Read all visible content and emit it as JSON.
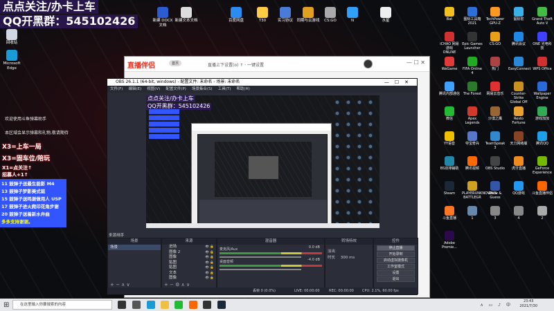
{
  "overlay": {
    "title": "点点关注/办卡上车",
    "qq": "QQ开黑群：545102426"
  },
  "desktop_top_icons": [
    {
      "label": "新建 DOCX 文档",
      "color": "#2b5cd1"
    },
    {
      "label": "新建文本文档",
      "color": "#dddddd"
    },
    {
      "label": "百度网盘",
      "color": "#2a8cf0"
    },
    {
      "label": "T30",
      "color": "#ffcc44"
    },
    {
      "label": "实习协议",
      "color": "#4a7bd8"
    },
    {
      "label": "同期与云游戏",
      "color": "#e0a020"
    },
    {
      "label": "CS:GO",
      "color": "#aaaaaa"
    },
    {
      "label": "N",
      "color": "#30a0ff"
    },
    {
      "label": "水星",
      "color": "#eeeeee"
    }
  ],
  "desktop_left_icons": [
    {
      "label": "回收站",
      "color": "#cfd8e0"
    },
    {
      "label": "Microsoft Edge",
      "color": "#1a9bd8"
    }
  ],
  "side_notes": [
    "欢迎使用斗鱼弹幕助手",
    "本区域会显示弹幕和礼物,敬请期待"
  ],
  "red_tags": [
    "X3=上车一局",
    "X3=固车位/陪玩",
    "X1=点关注↑",
    "招募人+1↑"
  ],
  "bluebox": {
    "lines": [
      "11 鼓弹子送最生能影 M4",
      "13 鼓弹子梦影美式驱",
      "15 鼓弹子送鸣谢做用人 USP",
      "17 鼓弹子进火爬印花角步谢",
      "20 鼓弹子送着新水弁曲"
    ],
    "footer": "多多支持谢谢。"
  },
  "browser": {
    "logo": "直播伴侣",
    "pill": "首页",
    "tabs": "直播上下设置(o) ↑ · 一键设置"
  },
  "obs": {
    "title": "OBS 26.1.1 (64-bit, windows) - 配置文件: 未命名 - 场景: 未命名",
    "menu": [
      "文件(F)",
      "编辑(E)",
      "视图(V)",
      "配置文件(P)",
      "场景集合(S)",
      "工具(T)",
      "帮助(H)"
    ],
    "preview_overlay_title": "点点关注/办卡上车",
    "preview_overlay_qq": "QQ开黑群：545102426",
    "dock_title_scene_label": "来源排序",
    "scenes_header": "场景",
    "scenes": [
      "场景"
    ],
    "sources_header": "来源",
    "sources": [
      "进场",
      "图像 2",
      "图像",
      "贴图",
      "贴图",
      "文本",
      "图像"
    ],
    "mixer_header": "混音器",
    "mixer": [
      {
        "name": "麦克风/Aux",
        "db": "0.0 dB"
      },
      {
        "name": "桌面音频",
        "db": "-4.0 dB"
      }
    ],
    "transitions_header": "转场特效",
    "transition_type": "淡出",
    "transition_duration_label": "时长",
    "transition_duration": "300 ms",
    "controls_header": "控件",
    "controls": [
      "停止直播",
      "开始录制",
      "启动虚拟摄像机",
      "工作室模式",
      "设置",
      "退出"
    ],
    "status": {
      "drop": "丢帧 0 (0.0%)",
      "live": "LIVE: 00:00:00",
      "rec": "REC: 00:00:00",
      "cpu": "CPU: 2.1%, 60.00 fps"
    }
  },
  "desktop_right_icons": [
    {
      "label": "Bat",
      "color": "#f0c020"
    },
    {
      "label": "图标工具箱 2021",
      "color": "#2c6fd8"
    },
    {
      "label": "TechPower GPU-Z",
      "color": "#ff9922"
    },
    {
      "label": "鼠标宏",
      "color": "#3ab0e8"
    },
    {
      "label": "Grand Theft Auto V",
      "color": "#44bb44"
    },
    {
      "label": "iCHAO 网易游戏 ONLINE",
      "color": "#d03030"
    },
    {
      "label": "Epic Games Launcher",
      "color": "#333333"
    },
    {
      "label": "CS:GO",
      "color": "#e8a018"
    },
    {
      "label": "腾讯会议",
      "color": "#1e88e5"
    },
    {
      "label": "ONE 光电科技",
      "color": "#4040ff"
    },
    {
      "label": "WeGame",
      "color": "#e03a3a"
    },
    {
      "label": "FIFA Online 4",
      "color": "#22aa22"
    },
    {
      "label": "热门",
      "color": "#aa4444"
    },
    {
      "label": "EasyConnect",
      "color": "#2a88d8"
    },
    {
      "label": "WPS Office",
      "color": "#d03030"
    },
    {
      "label": "腾讯内部通信",
      "color": "#40a0ff"
    },
    {
      "label": "The Forest",
      "color": "#2a7a2a"
    },
    {
      "label": "网易云音乐",
      "color": "#e03030"
    },
    {
      "label": "Counter-Strike Global Off",
      "color": "#c89020"
    },
    {
      "label": "Wallpaper Engine",
      "color": "#2a6ad8"
    },
    {
      "label": "微信",
      "color": "#22bb33"
    },
    {
      "label": "Apex Legends",
      "color": "#d03a2a"
    },
    {
      "label": "沙漠之鹰",
      "color": "#996633"
    },
    {
      "label": "Resto Fortune",
      "color": "#e8a030"
    },
    {
      "label": "游戏加加",
      "color": "#33aa55"
    },
    {
      "label": "YY语音",
      "color": "#f0c000"
    },
    {
      "label": "夺宝奇兵",
      "color": "#5577cc"
    },
    {
      "label": "TeamSpeak 3",
      "color": "#3388cc"
    },
    {
      "label": "天刀网络版",
      "color": "#884422"
    },
    {
      "label": "腾讯QQ",
      "color": "#1ea0e8"
    },
    {
      "label": "BS双排辅助",
      "color": "#2288aa"
    },
    {
      "label": "腾讯视频",
      "color": "#ff6a00"
    },
    {
      "label": "OBS Studio",
      "color": "#444444"
    },
    {
      "label": "虎牙直播",
      "color": "#f08a1a"
    },
    {
      "label": "GeForce Experience",
      "color": "#76b900"
    },
    {
      "label": "Steam",
      "color": "#1b2838"
    },
    {
      "label": "PLAYERUNKNOWN'S BATTLEGR",
      "color": "#d0a020"
    },
    {
      "label": "Draw & Guess",
      "color": "#3355aa"
    },
    {
      "label": "QQ游戏",
      "color": "#2299ee"
    },
    {
      "label": "斗鱼直播伴侣",
      "color": "#ff6600"
    },
    {
      "label": "斗鱼直播",
      "color": "#ff7722"
    },
    {
      "label": "1",
      "color": "#6688aa"
    },
    {
      "label": "3",
      "color": "#888888"
    },
    {
      "label": "4",
      "color": "#888888"
    },
    {
      "label": "2",
      "color": "#aaaaaa"
    },
    {
      "label": "Adobe Premie...",
      "color": "#2a0a4a"
    }
  ],
  "taskbar": {
    "search_placeholder": "在这里输入你要搜索的内容",
    "time": "23:43",
    "date": "2021/7/30",
    "apps": [
      {
        "name": "cortana",
        "color": "#333333"
      },
      {
        "name": "task-view",
        "color": "#555555"
      },
      {
        "name": "edge",
        "color": "#1a9bd8"
      },
      {
        "name": "explorer",
        "color": "#f0c040"
      },
      {
        "name": "wechat",
        "color": "#22bb33"
      },
      {
        "name": "douyu",
        "color": "#ff6600"
      },
      {
        "name": "obs",
        "color": "#333333"
      },
      {
        "name": "steam",
        "color": "#1b2838"
      }
    ]
  }
}
